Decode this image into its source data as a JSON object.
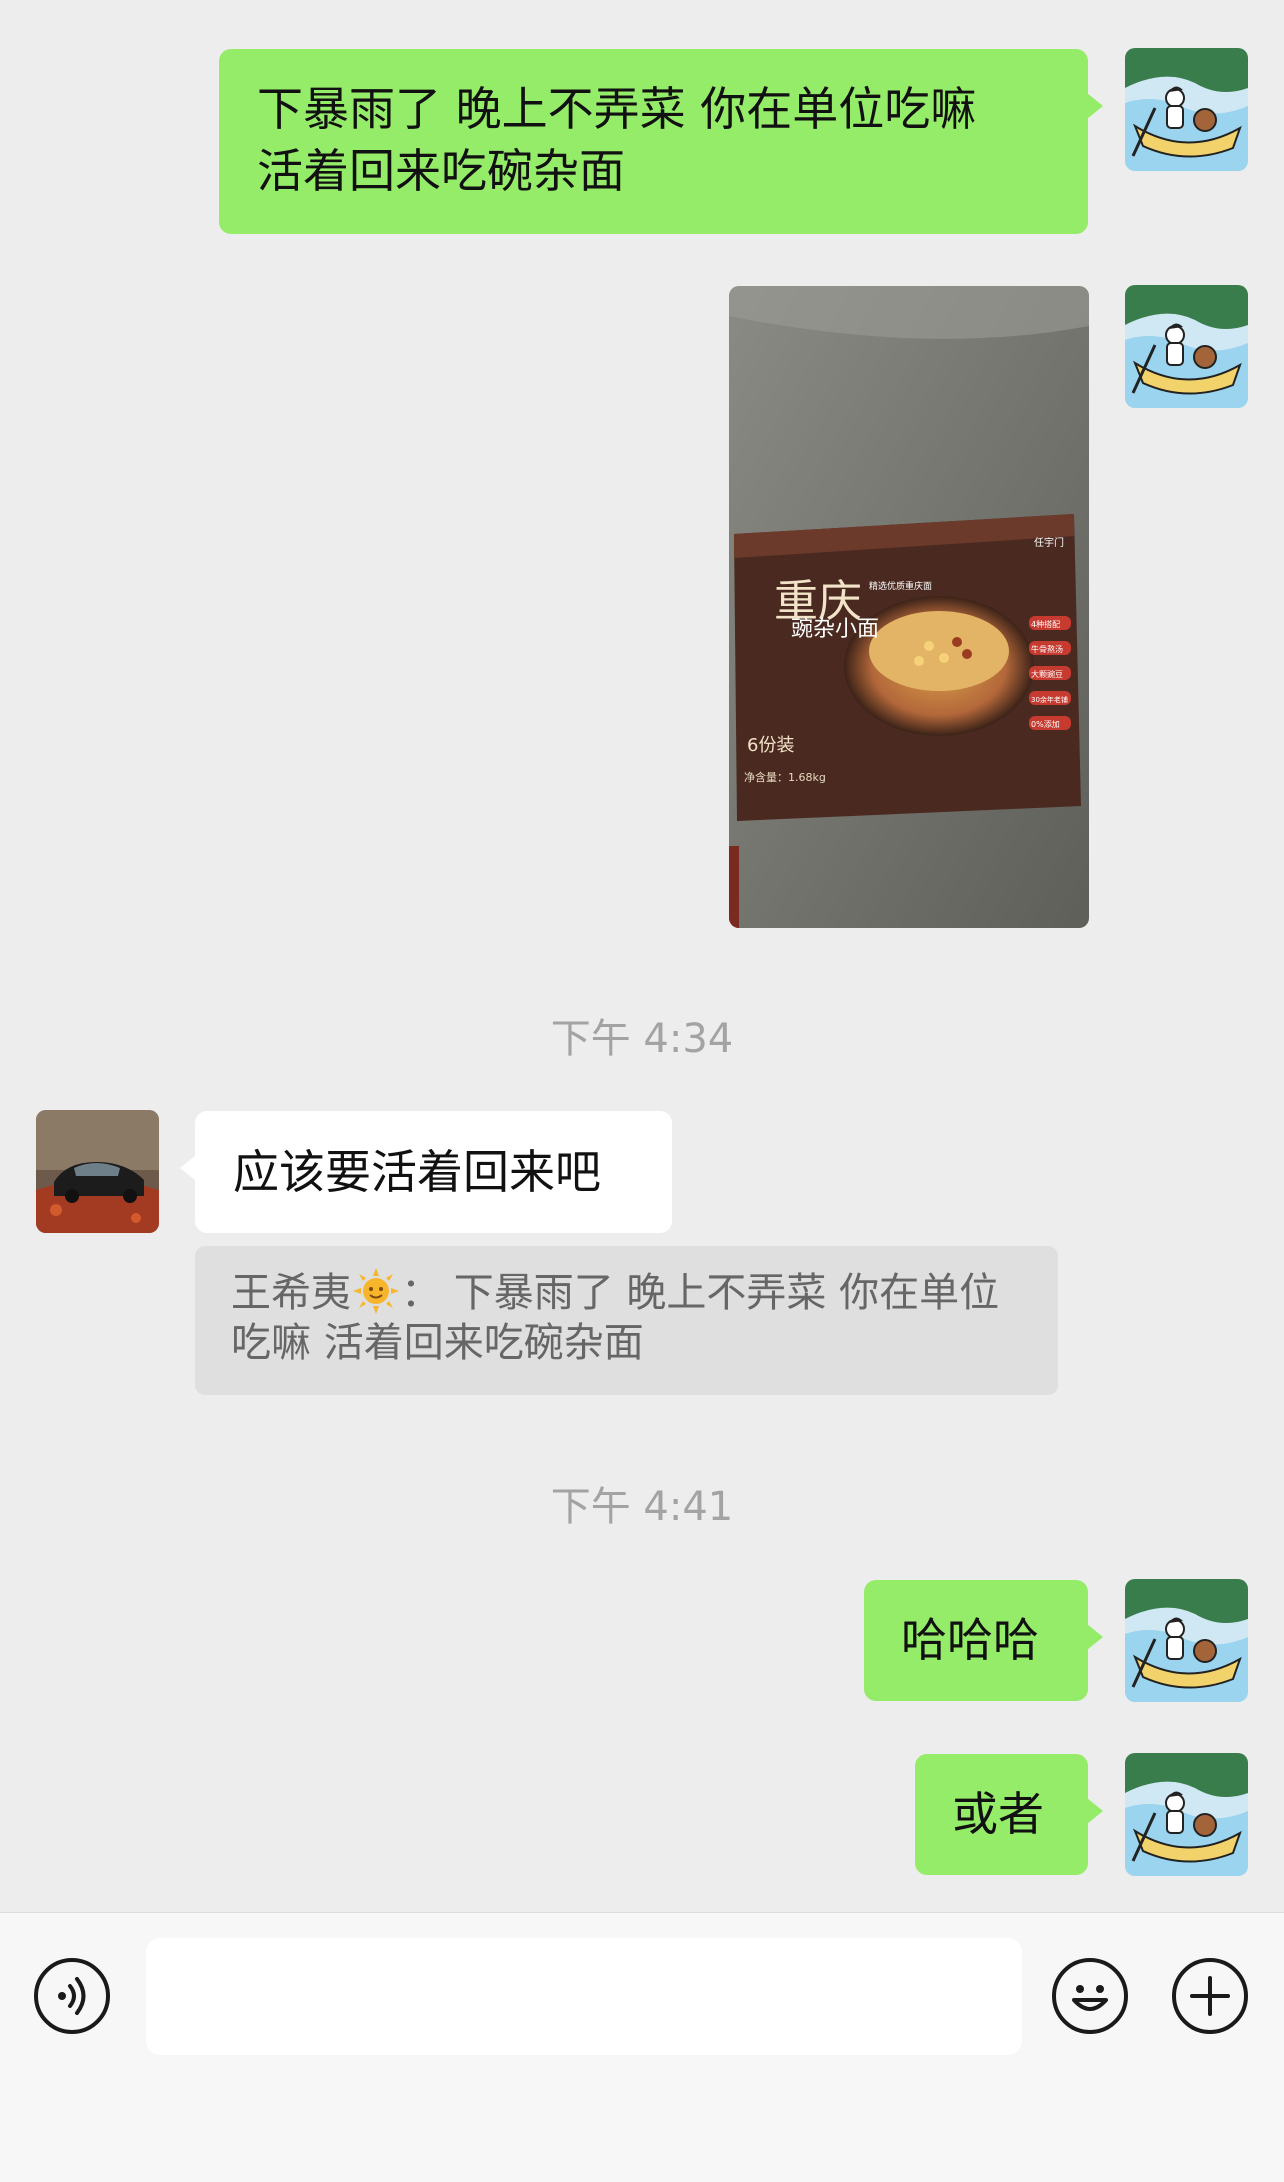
{
  "messages": [
    {
      "side": "me",
      "text": "下暴雨了 晚上不弄菜 你在单位吃嘛\n活着回来吃碗杂面"
    },
    {
      "side": "me",
      "type": "image",
      "image_text": {
        "brand": "任宇门",
        "title_big": "重庆",
        "title_small": "豌杂小面",
        "badge_top": "精选优质重庆面",
        "servings": "6份装",
        "net_weight": "净含量：1.68kg",
        "features": [
          "4种搭配",
          "牛骨熬汤",
          "大颗豌豆",
          "30余年老铺",
          "0%添加"
        ]
      }
    },
    {
      "side": "other",
      "text": "应该要活着回来吧",
      "quote": {
        "sender": "王希夷",
        "sep": "：",
        "text": "下暴雨了 晚上不弄菜 你在单位吃嘛 活着回来吃碗杂面"
      }
    },
    {
      "side": "me",
      "text": "哈哈哈"
    },
    {
      "side": "me",
      "text": "或者"
    }
  ],
  "timestamps": [
    "下午 4:34",
    "下午 4:41"
  ],
  "input": {
    "placeholder": ""
  },
  "icons": {
    "voice": "voice-icon",
    "emoji": "emoji-icon",
    "more": "plus-icon"
  },
  "colors": {
    "bubble_me": "#95ec69",
    "bubble_other": "#ffffff",
    "background": "#ededed"
  }
}
